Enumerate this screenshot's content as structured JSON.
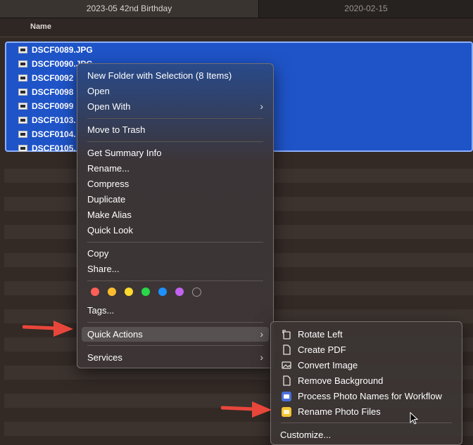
{
  "tabs": [
    {
      "label": "2023-05 42nd Birthday"
    },
    {
      "label": "2020-02-15"
    }
  ],
  "header": {
    "name_column": "Name"
  },
  "files": [
    "DSCF0089.JPG",
    "DSCF0090.JPG",
    "DSCF0092",
    "DSCF0098",
    "DSCF0099",
    "DSCF0103.",
    "DSCF0104.",
    "DSCF0105."
  ],
  "context_menu": {
    "new_folder": "New Folder with Selection (8 Items)",
    "open": "Open",
    "open_with": "Open With",
    "move_to_trash": "Move to Trash",
    "get_summary_info": "Get Summary Info",
    "rename": "Rename...",
    "compress": "Compress",
    "duplicate": "Duplicate",
    "make_alias": "Make Alias",
    "quick_look": "Quick Look",
    "copy": "Copy",
    "share": "Share...",
    "tags": "Tags...",
    "quick_actions": "Quick Actions",
    "services": "Services",
    "tag_colors": [
      "#fe5f57",
      "#febc2e",
      "#fed92e",
      "#28d74a",
      "#1e90ff",
      "#c262f0"
    ]
  },
  "quick_actions_menu": {
    "items": [
      {
        "label": "Rotate Left",
        "icon": "rotate-left-icon"
      },
      {
        "label": "Create PDF",
        "icon": "document-icon"
      },
      {
        "label": "Convert Image",
        "icon": "image-icon"
      },
      {
        "label": "Remove Background",
        "icon": "document-icon"
      },
      {
        "label": "Process Photo Names for Workflow",
        "icon": "workflow-icon"
      },
      {
        "label": "Rename Photo Files",
        "icon": "shortcut-icon"
      }
    ],
    "customize": "Customize..."
  },
  "colors": {
    "selection": "#1f54c8",
    "menu_highlight": "#1f56c8",
    "annotation_arrow": "#e8463a"
  }
}
